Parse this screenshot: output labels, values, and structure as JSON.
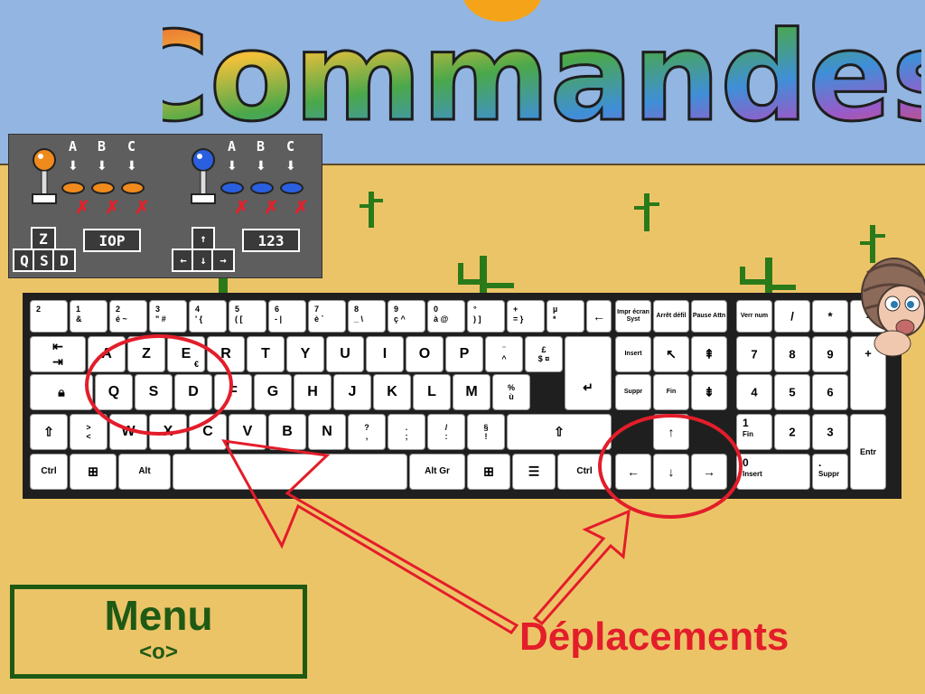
{
  "title": "Commandes",
  "controls": {
    "player1": {
      "buttons": [
        "A",
        "B",
        "C"
      ],
      "move_keys": [
        "Z",
        "Q",
        "S",
        "D"
      ],
      "action_keys": "IOP"
    },
    "player2": {
      "buttons": [
        "A",
        "B",
        "C"
      ],
      "move_keys": [
        "↑",
        "←",
        "↓",
        "→"
      ],
      "action_keys": "123"
    }
  },
  "keys": {
    "n2": "2",
    "k1": "1",
    "k1s": "&",
    "k2": "2",
    "k2s": "é ~",
    "k3": "3",
    "k3s": "\" #",
    "k4": "4",
    "k4s": "' {",
    "k5": "5",
    "k5s": "( [",
    "k6": "6",
    "k6s": "- |",
    "k7": "7",
    "k7s": "è `",
    "k8": "8",
    "k8s": "_ \\",
    "k9": "9",
    "k9s": "ç ^",
    "k0": "0",
    "k0s": "à @",
    "kdeg": "°",
    "kdegs": ") ]",
    "kplus": "+",
    "kpluss": "= }",
    "kmu": "µ",
    "kmus": "*",
    "A": "A",
    "Z": "Z",
    "E": "E",
    "Eeuro": "€",
    "R": "R",
    "T": "T",
    "Y": "Y",
    "U": "U",
    "I": "I",
    "O": "O",
    "P": "P",
    "trema": "¨",
    "caret": "^",
    "pound": "£",
    "dollar": "$ ¤",
    "Q": "Q",
    "S": "S",
    "D": "D",
    "F": "F",
    "G": "G",
    "H": "H",
    "J": "J",
    "K": "K",
    "L": "L",
    "M": "M",
    "percent": "%",
    "ugrave": "ù",
    "gt": ">",
    "lt": "<",
    "W": "W",
    "X": "X",
    "C": "C",
    "V": "V",
    "B": "B",
    "N": "N",
    "qmark": "?",
    "comma": ",",
    "dot": ".",
    "semicolon": ";",
    "slash": "/",
    "colon": ":",
    "section": "§",
    "excl": "!",
    "ctrl": "Ctrl",
    "alt": "Alt",
    "altgr": "Alt Gr",
    "ctrl2": "Ctrl",
    "impr": "Impr écran Syst",
    "arret": "Arrêt défil",
    "pause": "Pause Attn",
    "insert": "Insert",
    "suppr": "Suppr",
    "fin": "Fin",
    "verr": "Verr num",
    "npslash": "/",
    "npstar": "*",
    "npminus": "-",
    "npplus": "+",
    "np7": "7",
    "np8": "8",
    "np9": "9",
    "np4": "4",
    "np5": "5",
    "np6": "6",
    "np1": "1",
    "np1s": "Fin",
    "np2": "2",
    "np3": "3",
    "np0": "0",
    "np0s": "Insert",
    "npdot": ".",
    "npdots": "Suppr",
    "entr": "Entr"
  },
  "menu": {
    "title": "Menu",
    "key": "<o>"
  },
  "annotation": "Déplacements",
  "colors": {
    "sky": "#93b5e1",
    "sand": "#ecc468",
    "red": "#e31d2a",
    "green": "#1f5a14"
  }
}
